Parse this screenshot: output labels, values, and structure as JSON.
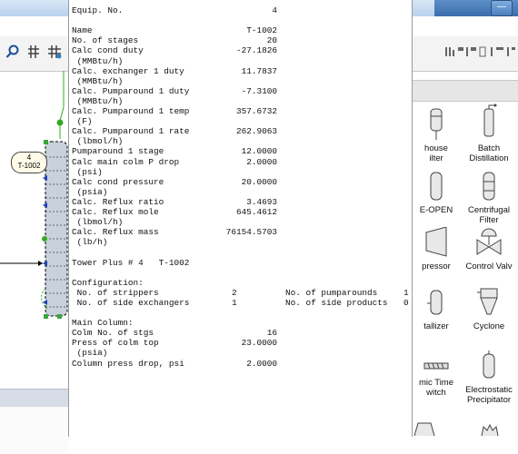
{
  "colors": {
    "titlebar": "#c6dbf2",
    "tower": "#c8d1dc",
    "stream_green": "#33aa22",
    "port_blue": "#1f3fbf"
  },
  "window_controls": {
    "minimize": "—",
    "maximize": "□"
  },
  "flowsheet": {
    "block_label": "4",
    "block_name": "T-1002"
  },
  "palette": [
    {
      "name": "house-filter",
      "label": "house\nilter",
      "icon": "filter-icon"
    },
    {
      "name": "batch-distillation",
      "label": "Batch\nDistillation",
      "icon": "batch-distillation-icon"
    },
    {
      "name": "e-open",
      "label": "E-OPEN",
      "icon": "vessel-icon"
    },
    {
      "name": "centrifugal-filter",
      "label": "Centrifugal\nFilter",
      "icon": "centrifugal-filter-icon"
    },
    {
      "name": "compressor",
      "label": "pressor",
      "icon": "compressor-icon"
    },
    {
      "name": "control-valve",
      "label": "Control Valv",
      "icon": "control-valve-icon"
    },
    {
      "name": "crystallizer",
      "label": "tallizer",
      "icon": "crystallizer-icon"
    },
    {
      "name": "cyclone",
      "label": "Cyclone",
      "icon": "cyclone-icon"
    },
    {
      "name": "dynamic-time-switch",
      "label": "mic Time\nwitch",
      "icon": "switch-icon"
    },
    {
      "name": "electrostatic-precipitator",
      "label": "Electrostatic\nPrecipitator",
      "icon": "precipitator-icon"
    }
  ],
  "report": {
    "lines": [
      {
        "l": "Equip. No.",
        "v": "4"
      },
      {
        "l": "",
        "v": ""
      },
      {
        "l": "Name",
        "v": "T-1002"
      },
      {
        "l": "No. of stages",
        "v": "20"
      },
      {
        "l": "Calc cond duty",
        "v": "-27.1826"
      },
      {
        "l": " (MMBtu/h)",
        "v": ""
      },
      {
        "l": "Calc. exchanger 1 duty",
        "v": "11.7837"
      },
      {
        "l": " (MMBtu/h)",
        "v": ""
      },
      {
        "l": "Calc. Pumparound 1 duty",
        "v": "-7.3100"
      },
      {
        "l": " (MMBtu/h)",
        "v": ""
      },
      {
        "l": "Calc. Pumparound 1 temp",
        "v": "357.6732"
      },
      {
        "l": " (F)",
        "v": ""
      },
      {
        "l": "Calc. Pumparound 1 rate",
        "v": "262.9063"
      },
      {
        "l": " (lbmol/h)",
        "v": ""
      },
      {
        "l": "Pumparound 1 stage",
        "v": "12.0000"
      },
      {
        "l": "Calc main colm P drop",
        "v": "2.0000"
      },
      {
        "l": " (psi)",
        "v": ""
      },
      {
        "l": "Calc cond pressure",
        "v": "20.0000"
      },
      {
        "l": " (psia)",
        "v": ""
      },
      {
        "l": "Calc. Reflux ratio",
        "v": "3.4693"
      },
      {
        "l": "Calc. Reflux mole",
        "v": "645.4612"
      },
      {
        "l": " (lbmol/h)",
        "v": ""
      },
      {
        "l": "Calc. Reflux mass",
        "v": "76154.5703"
      },
      {
        "l": " (lb/h)",
        "v": ""
      },
      {
        "l": "",
        "v": ""
      },
      {
        "l": "Tower Plus # 4   T-1002",
        "v": ""
      },
      {
        "l": "",
        "v": ""
      },
      {
        "l": "Configuration:",
        "v": ""
      },
      {
        "l": " No. of strippers",
        "v": "2",
        "l2": "No. of pumparounds",
        "v2": "1"
      },
      {
        "l": " No. of side exchangers",
        "v": "1",
        "l2": "No. of side products",
        "v2": "0"
      },
      {
        "l": "",
        "v": ""
      },
      {
        "l": "Main Column:",
        "v": ""
      },
      {
        "l": "Colm No. of stgs",
        "v": "16"
      },
      {
        "l": "Press of colm top",
        "v": "23.0000"
      },
      {
        "l": " (psia)",
        "v": ""
      },
      {
        "l": "Column press drop, psi",
        "v": "2.0000"
      }
    ]
  }
}
